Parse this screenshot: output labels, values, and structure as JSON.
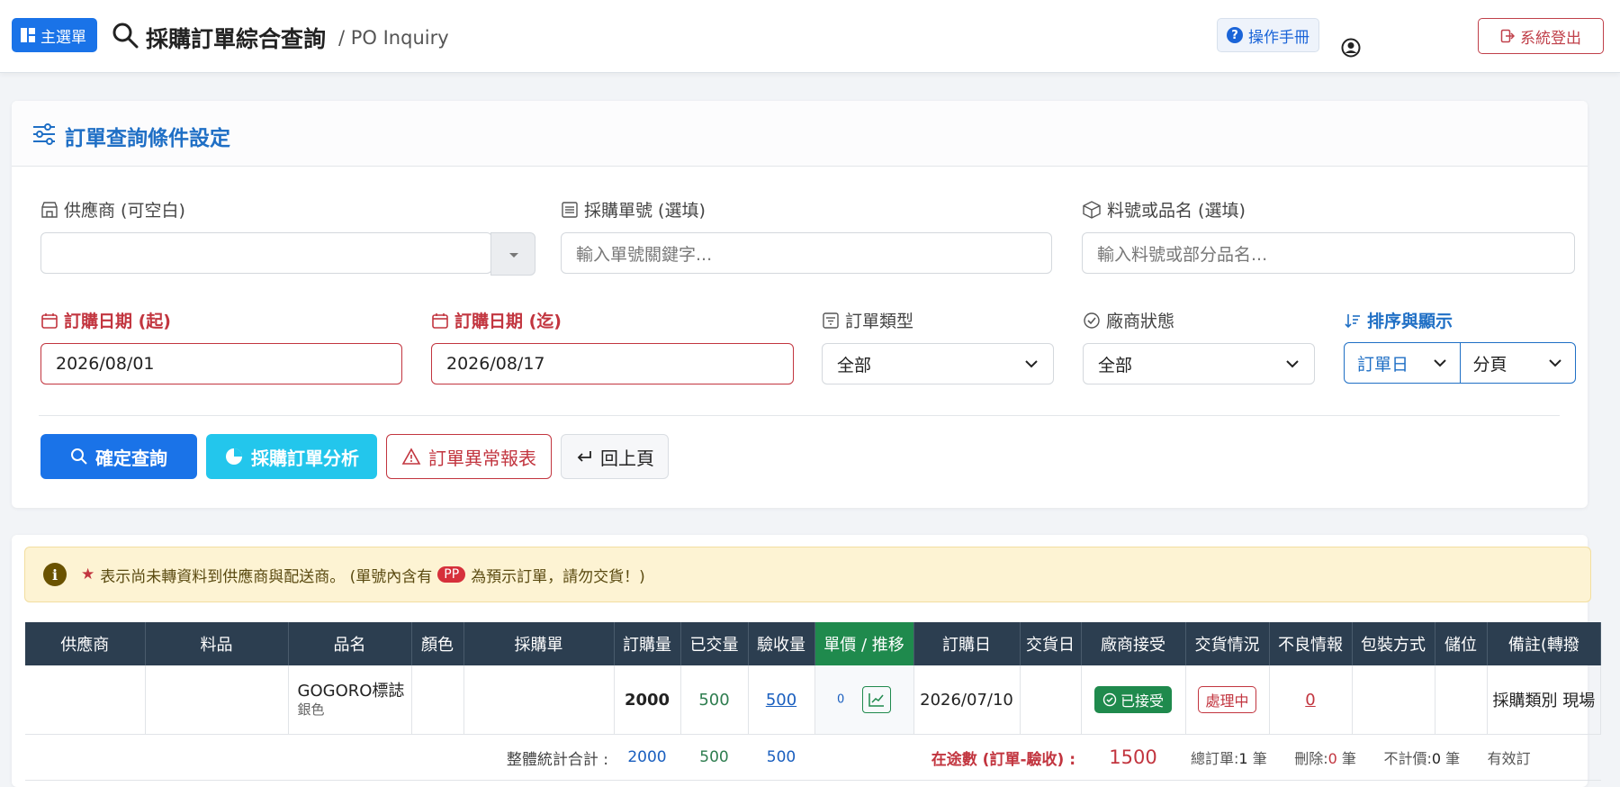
{
  "header": {
    "menu_label": "主選單",
    "title": "採購訂單綜合查詢",
    "subtitle": "/ PO Inquiry",
    "manual_label": "操作手冊",
    "logout_label": "系統登出"
  },
  "filter": {
    "card_title": "訂單查詢條件設定",
    "supplier_label": "供應商 (可空白)",
    "supplier_value": "",
    "po_label": "採購單號 (選填)",
    "po_placeholder": "輸入單號關鍵字...",
    "item_label": "料號或品名 (選填)",
    "item_placeholder": "輸入料號或部分品名...",
    "date_from_label": "訂購日期 (起)",
    "date_from_value": "2026/08/01",
    "date_to_label": "訂購日期 (迄)",
    "date_to_value": "2026/08/17",
    "order_type_label": "訂單類型",
    "order_type_value": "全部",
    "vendor_status_label": "廠商狀態",
    "vendor_status_value": "全部",
    "sort_label": "排序與顯示",
    "sort_value": "訂單日",
    "display_value": "分頁",
    "btn_search": "確定查詢",
    "btn_analysis": "採購訂單分析",
    "btn_exception": "訂單異常報表",
    "btn_back": "回上頁"
  },
  "notice": {
    "star": "★",
    "text_1": "表示尚未轉資料到供應商與配送商。 (單號內含有",
    "pp": "PP",
    "text_2": "為預示訂單，請勿交貨！)"
  },
  "table": {
    "headers": [
      "供應商",
      "料品",
      "品名",
      "顏色",
      "採購單",
      "訂購量",
      "已交量",
      "驗收量",
      "單價 / 推移",
      "訂購日",
      "交貨日",
      "廠商接受",
      "交貨情況",
      "不良情報",
      "包裝方式",
      "儲位",
      "備註(轉撥"
    ],
    "row": {
      "supplier": "",
      "item": "",
      "name": "GOGORO標誌",
      "name_sub": "銀色",
      "color": "",
      "po": "",
      "qty": "2000",
      "delivered": "500",
      "accepted": "500",
      "unit_price": "0",
      "order_date": "2026/07/10",
      "delivery_date": "",
      "vendor_accept": "已接受",
      "delivery_status": "處理中",
      "defect": "0",
      "packing": "",
      "location": "",
      "remark": "採購類別 現場"
    },
    "summary": {
      "label": "整體統計合計 :",
      "qty": "2000",
      "delivered": "500",
      "accepted": "500",
      "transit_label": "在途數 (訂單-驗收) :",
      "transit_value": "1500",
      "total_label": "總訂單:",
      "total_value": "1",
      "deleted_label": "刪除:",
      "deleted_value": "0",
      "noprice_label": "不計價:",
      "noprice_value": "0",
      "valid_label": "有效訂",
      "unit": "筆"
    }
  }
}
